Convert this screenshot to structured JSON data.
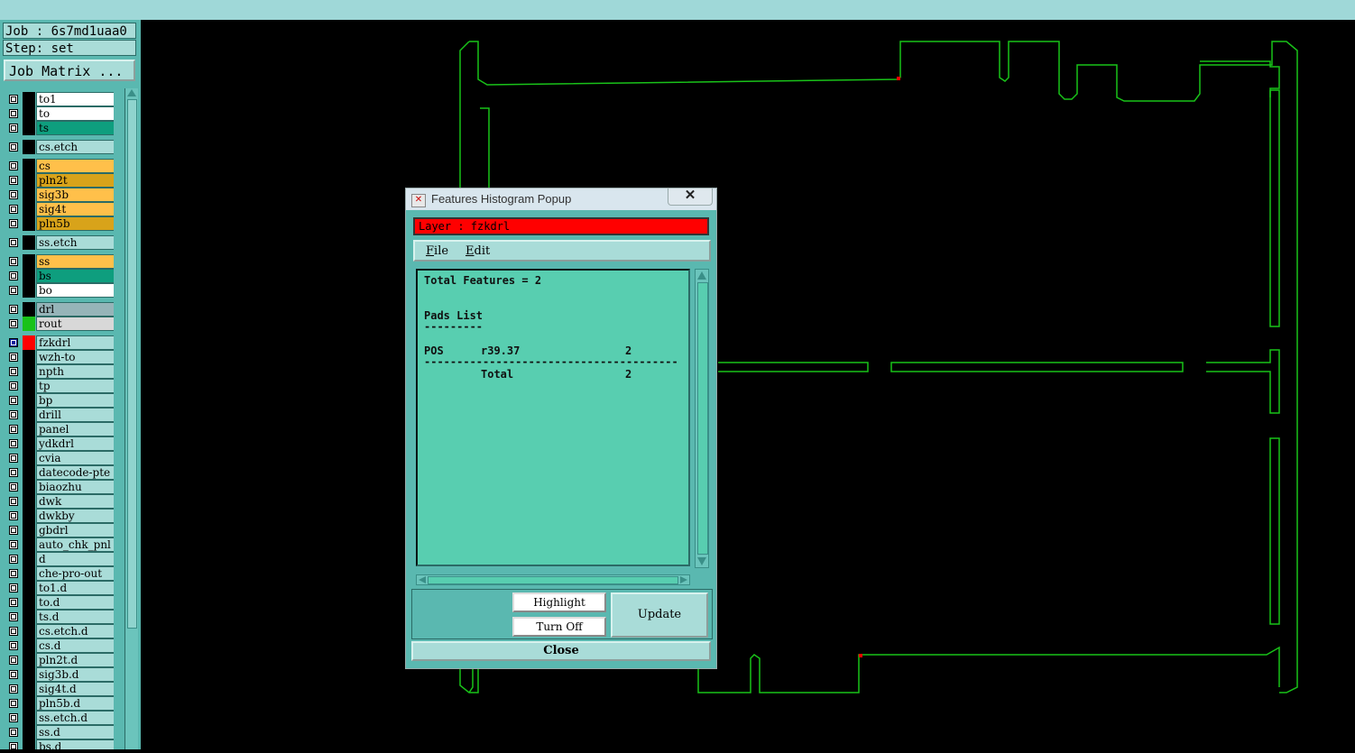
{
  "job_label": "Job : 6s7md1uaa0",
  "step_label": "Step: set",
  "job_matrix_label": "Job Matrix ...",
  "layers": [
    {
      "name": "to1",
      "bg": "#ffffff",
      "sel": false,
      "color": "#000000"
    },
    {
      "name": "to",
      "bg": "#ffffff",
      "sel": false,
      "color": "#000000"
    },
    {
      "name": "ts",
      "bg": "#0e9e7e",
      "sel": false,
      "color": "#000000"
    },
    {
      "name": "cs.etch",
      "bg": "#a9dcd8",
      "sel": false,
      "color": "#000000"
    },
    {
      "name": "cs",
      "bg": "#ffc04a",
      "sel": false,
      "color": "#000000"
    },
    {
      "name": "pln2t",
      "bg": "#d8a31a",
      "sel": false,
      "color": "#000000"
    },
    {
      "name": "sig3b",
      "bg": "#ffc04a",
      "sel": false,
      "color": "#000000"
    },
    {
      "name": "sig4t",
      "bg": "#ffc04a",
      "sel": false,
      "color": "#000000"
    },
    {
      "name": "pln5b",
      "bg": "#d8a31a",
      "sel": false,
      "color": "#000000"
    },
    {
      "name": "ss.etch",
      "bg": "#a9dcd8",
      "sel": false,
      "color": "#000000"
    },
    {
      "name": "ss",
      "bg": "#ffc04a",
      "sel": false,
      "color": "#000000"
    },
    {
      "name": "bs",
      "bg": "#0e9e7e",
      "sel": false,
      "color": "#000000"
    },
    {
      "name": "bo",
      "bg": "#ffffff",
      "sel": false,
      "color": "#000000"
    },
    {
      "name": "drl",
      "bg": "#96b4b8",
      "sel": false,
      "color": "#000000"
    },
    {
      "name": "rout",
      "bg": "#d8d8d8",
      "sel": false,
      "color": "#19c219"
    },
    {
      "name": "fzkdrl",
      "bg": "#a9dcd8",
      "sel": true,
      "color": "#ff0000"
    },
    {
      "name": "wzh-to",
      "bg": "#a9dcd8",
      "sel": false,
      "color": "#000000"
    },
    {
      "name": "npth",
      "bg": "#a9dcd8",
      "sel": false,
      "color": "#000000"
    },
    {
      "name": "tp",
      "bg": "#a9dcd8",
      "sel": false,
      "color": "#000000"
    },
    {
      "name": "bp",
      "bg": "#a9dcd8",
      "sel": false,
      "color": "#000000"
    },
    {
      "name": "drill",
      "bg": "#a9dcd8",
      "sel": false,
      "color": "#000000"
    },
    {
      "name": "panel",
      "bg": "#a9dcd8",
      "sel": false,
      "color": "#000000"
    },
    {
      "name": "ydkdrl",
      "bg": "#a9dcd8",
      "sel": false,
      "color": "#000000"
    },
    {
      "name": "cvia",
      "bg": "#a9dcd8",
      "sel": false,
      "color": "#000000"
    },
    {
      "name": "datecode-pte",
      "bg": "#a9dcd8",
      "sel": false,
      "color": "#000000"
    },
    {
      "name": "biaozhu",
      "bg": "#a9dcd8",
      "sel": false,
      "color": "#000000"
    },
    {
      "name": "dwk",
      "bg": "#a9dcd8",
      "sel": false,
      "color": "#000000"
    },
    {
      "name": "dwkby",
      "bg": "#a9dcd8",
      "sel": false,
      "color": "#000000"
    },
    {
      "name": "gbdrl",
      "bg": "#a9dcd8",
      "sel": false,
      "color": "#000000"
    },
    {
      "name": "auto_chk_pnl",
      "bg": "#a9dcd8",
      "sel": false,
      "color": "#000000"
    },
    {
      "name": "d",
      "bg": "#a9dcd8",
      "sel": false,
      "color": "#000000"
    },
    {
      "name": "che-pro-out",
      "bg": "#a9dcd8",
      "sel": false,
      "color": "#000000"
    },
    {
      "name": "to1.d",
      "bg": "#a9dcd8",
      "sel": false,
      "color": "#000000"
    },
    {
      "name": "to.d",
      "bg": "#a9dcd8",
      "sel": false,
      "color": "#000000"
    },
    {
      "name": "ts.d",
      "bg": "#a9dcd8",
      "sel": false,
      "color": "#000000"
    },
    {
      "name": "cs.etch.d",
      "bg": "#a9dcd8",
      "sel": false,
      "color": "#000000"
    },
    {
      "name": "cs.d",
      "bg": "#a9dcd8",
      "sel": false,
      "color": "#000000"
    },
    {
      "name": "pln2t.d",
      "bg": "#a9dcd8",
      "sel": false,
      "color": "#000000"
    },
    {
      "name": "sig3b.d",
      "bg": "#a9dcd8",
      "sel": false,
      "color": "#000000"
    },
    {
      "name": "sig4t.d",
      "bg": "#a9dcd8",
      "sel": false,
      "color": "#000000"
    },
    {
      "name": "pln5b.d",
      "bg": "#a9dcd8",
      "sel": false,
      "color": "#000000"
    },
    {
      "name": "ss.etch.d",
      "bg": "#a9dcd8",
      "sel": false,
      "color": "#000000"
    },
    {
      "name": "ss.d",
      "bg": "#a9dcd8",
      "sel": false,
      "color": "#000000"
    },
    {
      "name": "bs.d",
      "bg": "#a9dcd8",
      "sel": false,
      "color": "#000000"
    }
  ],
  "popup": {
    "title": "Features Histogram Popup",
    "close_x": "✕",
    "layer_label": "Layer :  fzkdrl",
    "menu": {
      "file": "File",
      "edit": "Edit"
    },
    "report": {
      "total_features": "Total Features = 2",
      "section": "Pads List",
      "underline": "---------",
      "row_label": "POS",
      "row_symbol": "r39.37",
      "row_count": "2",
      "divider": "---------------------------------------",
      "total_label": "Total",
      "total_count": "2"
    },
    "highlight_label": "Highlight",
    "turnoff_label": "Turn Off",
    "update_label": "Update",
    "close_label": "Close"
  },
  "colors": {
    "outline": "#19c219",
    "accent_red": "#ff0000",
    "panel_teal": "#5ab8b0"
  }
}
